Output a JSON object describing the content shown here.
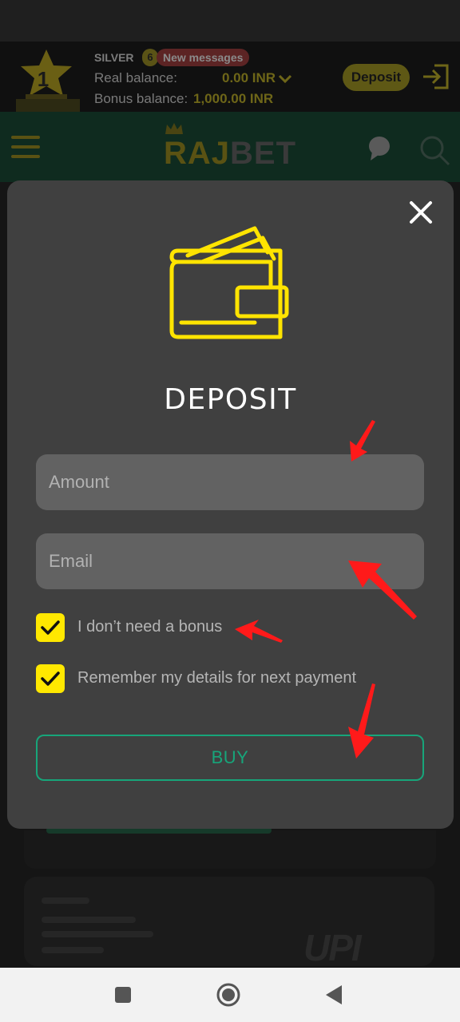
{
  "account": {
    "level": "SILVER",
    "level_number": "1",
    "message_count": "6",
    "messages_label": "New messages",
    "real_balance_label": "Real balance:",
    "real_balance_value": "0.00 INR",
    "bonus_balance_label": "Bonus balance:",
    "bonus_balance_value": "1,000.00 INR",
    "deposit_label": "Deposit"
  },
  "header": {
    "logo_part1": "RAJ",
    "logo_part2": "BET"
  },
  "modal": {
    "title": "DEPOSIT",
    "amount_placeholder": "Amount",
    "email_placeholder": "Email",
    "checkbox_bonus_label": "I don’t need a bonus",
    "checkbox_bonus_checked": true,
    "checkbox_remember_label": "Remember my details for next payment",
    "checkbox_remember_checked": true,
    "buy_label": "BUY"
  },
  "background": {
    "upi_logo": "UPI"
  },
  "colors": {
    "accent_yellow": "#ffe800",
    "buy_green": "#17a57a",
    "modal_bg": "#404040",
    "annotation_red": "#ff1a1a"
  },
  "icons": [
    "trophy-icon",
    "chevron-down-icon",
    "login-icon",
    "menu-icon",
    "chat-icon",
    "search-icon",
    "close-icon",
    "wallet-icon",
    "checkmark-icon",
    "square-nav-icon",
    "home-nav-icon",
    "back-nav-icon"
  ]
}
